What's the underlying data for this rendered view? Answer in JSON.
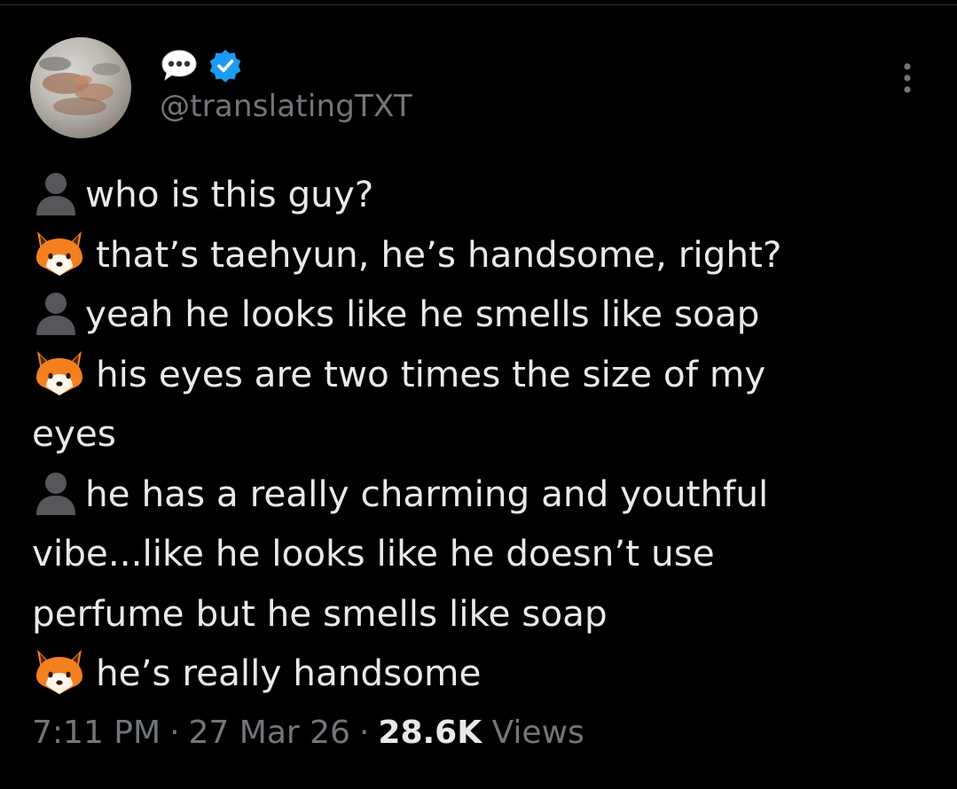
{
  "author": {
    "display_icons": [
      "speech-balloon-icon",
      "verified-badge-icon"
    ],
    "handle": "@translatingTXT",
    "verified_color": "#1d9bf0"
  },
  "tweet": {
    "lines": [
      {
        "icon": "bust-silhouette-icon",
        "text": "who is this guy?"
      },
      {
        "icon": "fox-face-icon",
        "text": "that’s taehyun, he’s handsome, right?"
      },
      {
        "icon": "bust-silhouette-icon",
        "text": "yeah he looks like he smells like soap"
      },
      {
        "icon": "fox-face-icon",
        "text": "his eyes are two times the size of my"
      },
      {
        "icon": "",
        "text": "eyes"
      },
      {
        "icon": "bust-silhouette-icon",
        "text": "he has a really charming and youthful"
      },
      {
        "icon": "",
        "text": "vibe...like he looks like he doesn’t use"
      },
      {
        "icon": "",
        "text": "perfume but he smells like soap"
      },
      {
        "icon": "fox-face-icon",
        "text": "he’s really handsome"
      }
    ]
  },
  "meta": {
    "time": "7:11 PM",
    "separator": "·",
    "date": "27 Mar 26",
    "views_count": "28.6K",
    "views_label": "Views"
  },
  "colors": {
    "background": "#000000",
    "text": "#e7e9ea",
    "secondary_text": "#71767b",
    "fox_orange": "#f4801f"
  }
}
